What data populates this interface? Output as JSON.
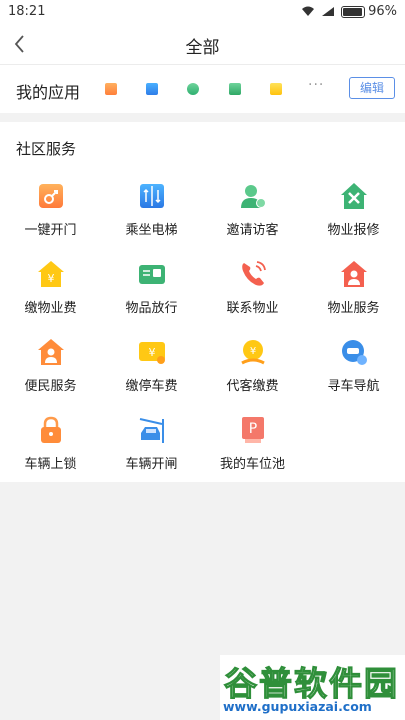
{
  "status": {
    "time": "18:21",
    "battery": "96%"
  },
  "nav": {
    "title": "全部"
  },
  "my_apps": {
    "label": "我的应用",
    "more": "···",
    "edit_label": "编辑",
    "mini_icons": [
      "door-icon",
      "elevator-icon",
      "visitor-icon",
      "repair-icon",
      "fee-icon"
    ]
  },
  "services": {
    "title": "社区服务",
    "items": [
      {
        "label": "一键开门",
        "icon": "key-door-icon"
      },
      {
        "label": "乘坐电梯",
        "icon": "elevator-icon"
      },
      {
        "label": "邀请访客",
        "icon": "invite-visitor-icon"
      },
      {
        "label": "物业报修",
        "icon": "repair-house-icon"
      },
      {
        "label": "缴物业费",
        "icon": "property-fee-icon"
      },
      {
        "label": "物品放行",
        "icon": "goods-release-icon"
      },
      {
        "label": "联系物业",
        "icon": "phone-icon"
      },
      {
        "label": "物业服务",
        "icon": "property-service-icon"
      },
      {
        "label": "便民服务",
        "icon": "convenience-icon"
      },
      {
        "label": "缴停车费",
        "icon": "parking-fee-icon"
      },
      {
        "label": "代客缴费",
        "icon": "proxy-pay-icon"
      },
      {
        "label": "寻车导航",
        "icon": "car-navigation-icon"
      },
      {
        "label": "车辆上锁",
        "icon": "car-lock-icon"
      },
      {
        "label": "车辆开闸",
        "icon": "car-gate-icon"
      },
      {
        "label": "我的车位池",
        "icon": "parking-space-icon"
      }
    ]
  },
  "watermark": {
    "title": "谷普软件园",
    "url": "www.gupuxiazai.com"
  }
}
